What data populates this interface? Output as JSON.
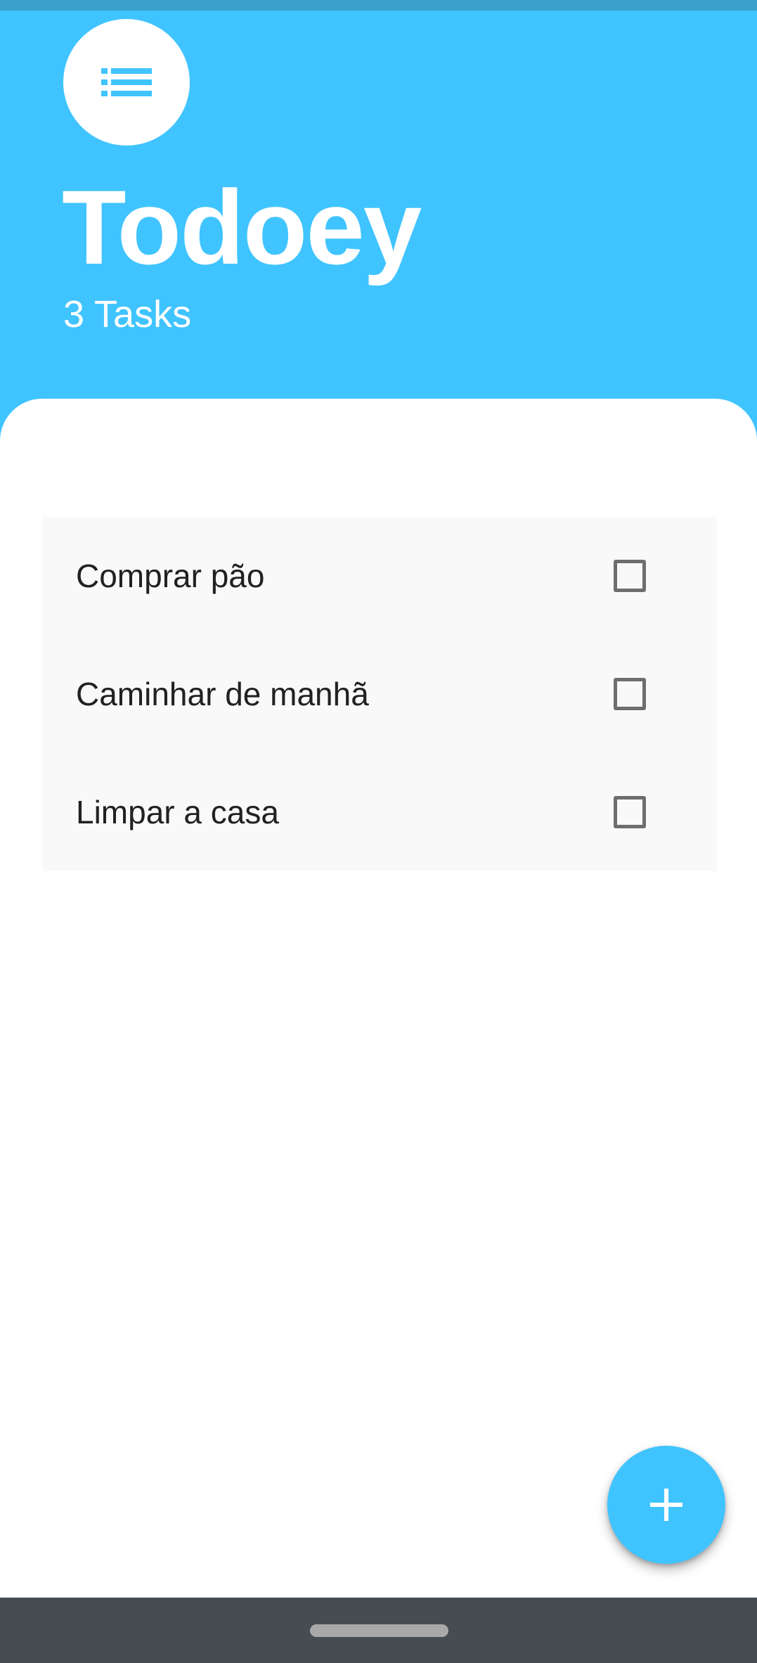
{
  "app": {
    "title": "Todoey",
    "task_count_label": "3 Tasks"
  },
  "header": {
    "avatar_icon": "list-icon"
  },
  "tasks": [
    {
      "label": "Comprar pão",
      "checked": false
    },
    {
      "label": "Caminhar de manhã",
      "checked": false
    },
    {
      "label": "Limpar a casa",
      "checked": false
    }
  ],
  "fab": {
    "icon": "plus-icon"
  },
  "colors": {
    "accent": "#40c4ff",
    "status_bar": "#3aa0cc",
    "nav_bar": "#464d52",
    "task_background": "#f9f9f9",
    "text": "#212121",
    "checkbox_border": "#6e6e6e"
  }
}
